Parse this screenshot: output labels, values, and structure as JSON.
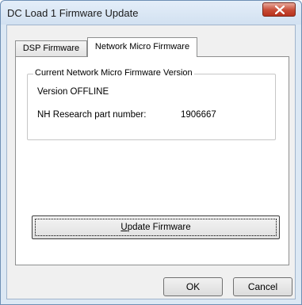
{
  "window": {
    "title": "DC Load 1 Firmware Update"
  },
  "tabs": [
    {
      "label": "DSP Firmware",
      "active": false
    },
    {
      "label": "Network Micro Firmware",
      "active": true
    }
  ],
  "group": {
    "legend": "Current Network Micro Firmware Version",
    "version": "Version OFFLINE",
    "part_label": "NH Research part number:",
    "part_number": "1906667"
  },
  "update_button": {
    "mnemonic": "U",
    "rest": "pdate Firmware"
  },
  "buttons": {
    "ok": "OK",
    "cancel": "Cancel"
  },
  "colors": {
    "close_button": "#c74b35",
    "titlebar": "#d2e1f1"
  },
  "icons": {
    "close": "close-x-icon"
  }
}
